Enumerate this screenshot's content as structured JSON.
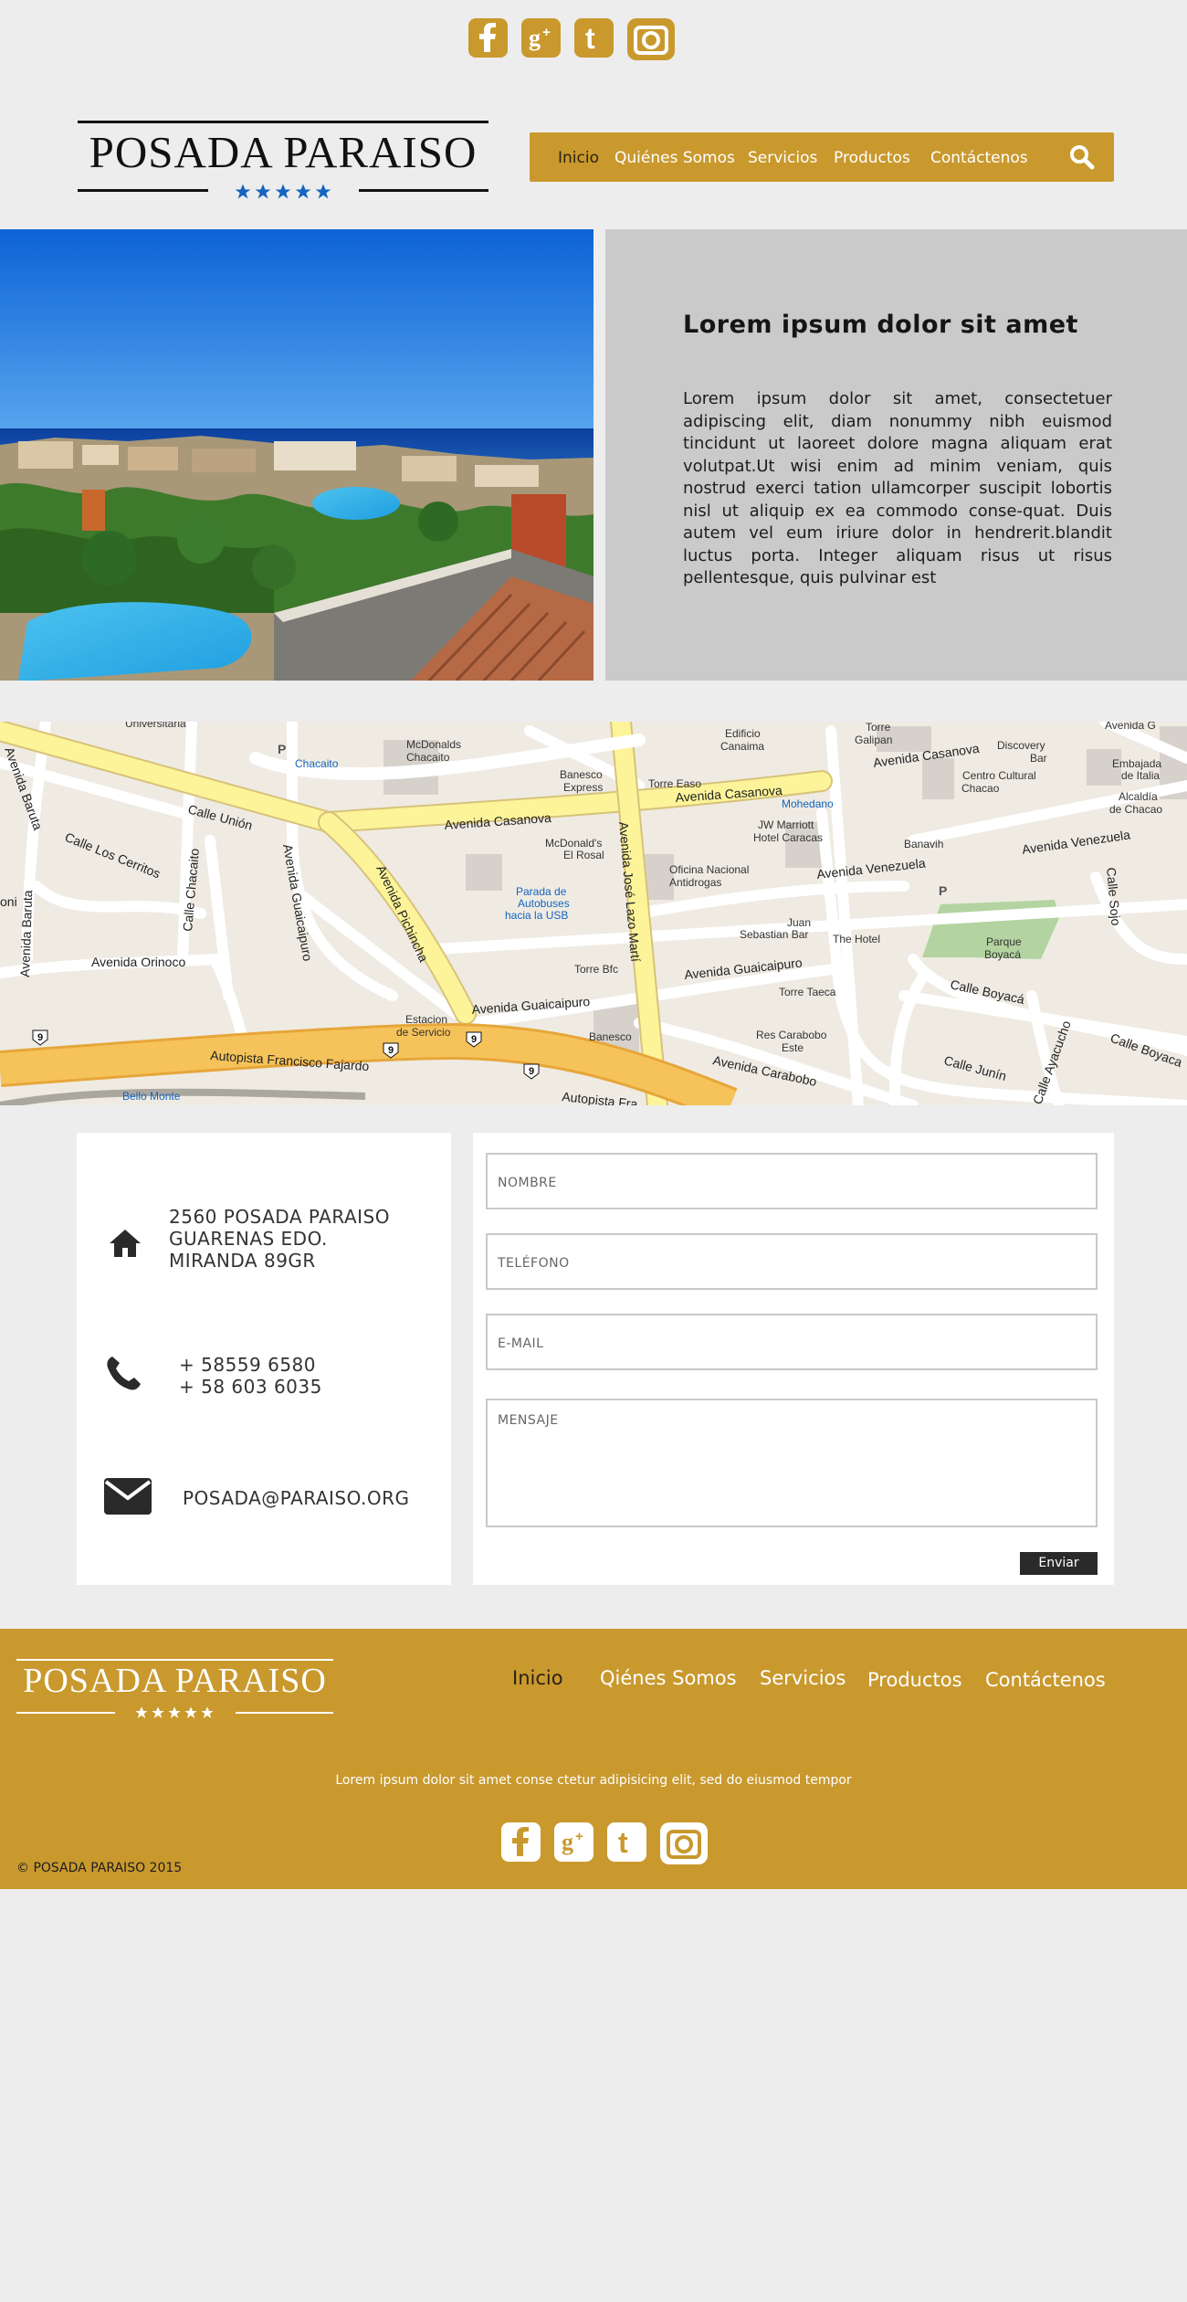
{
  "brand": {
    "name": "POSADA PARAISO",
    "accent_color": "#c9992e",
    "star_color_header": "#1565c0",
    "star_color_footer": "#ffffff",
    "stars": 5
  },
  "social": [
    "facebook-icon",
    "google-plus-icon",
    "tumblr-icon",
    "camera-icon"
  ],
  "nav": {
    "items": [
      "Inicio",
      "Quiénes Somos",
      "Servicios",
      "Productos",
      "Contáctenos"
    ],
    "active": "Inicio"
  },
  "hero": {
    "title": "Lorem ipsum dolor sit amet",
    "body": "Lorem ipsum dolor sit amet, consectetuer adipiscing elit, diam nonummy nibh euismod tincidunt ut laoreet dolore magna aliquam erat volutpat.Ut wisi enim ad minim veniam, quis nostrud exerci tation ullamcorper suscipit lobortis nisl ut aliquip ex ea commodo conse-quat. Duis autem vel eum iriure dolor in hendrerit.blandit luctus porta. Integer aliquam risus ut risus pellentesque, quis pulvinar est"
  },
  "map": {
    "labels": {
      "universitaria": "Universitaria",
      "edificio": "Edificio\nCanaima",
      "torre_galipan": "Torre\nGalipan",
      "avenida_g": "Avenida G",
      "chacaito": "Chacaito",
      "mcdonalds_chacaito": "McDonalds\nChacaito",
      "banesco_express": "Banesco\nExpress",
      "torre_easo": "Torre Easo",
      "av_casanova_1": "Avenida Casanova",
      "av_casanova_2": "Avenida Casanova",
      "av_casanova_3": "Avenida Casanova",
      "discovery": "Discovery\nBar",
      "embajada": "Embajada\nde Italia",
      "centro_cultural": "Centro Cultural\nChacao",
      "alcaldia": "Alcaldía\nde Chacao",
      "calle_union": "Calle Unión",
      "av_baruta": "Avenida Baruta",
      "av_baruta_2": "Avenida Baruta",
      "mohedano": "Mohedano",
      "jw_marriott": "JW Marriott\nHotel Caracas",
      "banavih": "Banavih",
      "av_venezuela_1": "Avenida Venezuela",
      "av_venezuela_2": "Avenida Venezuela",
      "calle_los_cerritos": "Calle Los Cerritos",
      "calle_chacaito": "Calle Chacaito",
      "av_guaicaipuro_v": "Avenida Guaicaipuro",
      "av_pichincha": "Avenida Pichincha",
      "mcdonalds_rosal": "McDonald's\nEl Rosal",
      "av_jose_lazo": "Avenida José Lazo Martí",
      "oficina": "Oficina Nacional\nAntidrogas",
      "calle_sojo": "Calle Sojo",
      "parada": "Parada de\nAutobuses\nhacia la USB",
      "av_orinoco": "Avenida Orinoco",
      "juan_sebastian": "Juan\nSebastian Bar",
      "the_hotel": "The Hotel",
      "parque_boyaca": "Parque\nBoyacá",
      "torre_bfc": "Torre Bfc",
      "av_guaicaipuro_1": "Avenida Guaicaipuro",
      "av_guaicaipuro_2": "Avenida Guaicaipuro",
      "torre_taeca": "Torre Taeca",
      "calle_boyaca_1": "Calle Boyacá",
      "calle_boyaca_2": "Calle Boyaca",
      "estacion": "Estacion\nde Servicio",
      "banesco": "Banesco",
      "res_carabobo": "Res Carabobo\nEste",
      "calle_junin": "Calle Junín",
      "calle_ayacucho": "Calle Ayacucho",
      "autopista_ff": "Autopista Francisco Fajardo",
      "autopista_2": "Autopista Fra",
      "av_carabobo": "Avenida Carabobo",
      "bello_monte": "Bello Monte",
      "p": "P",
      "nine": "9",
      "aoi": "oni"
    }
  },
  "contact": {
    "address_lines": [
      "2560 POSADA PARAISO",
      "GUARENAS EDO.",
      "MIRANDA 89GR"
    ],
    "phones": [
      "+ 58559 6580",
      "+ 58 603 6035"
    ],
    "email": "POSADA@PARAISO.ORG",
    "form": {
      "name_placeholder": "NOMBRE",
      "phone_placeholder": "TELÉFONO",
      "email_placeholder": "E-MAIL",
      "message_placeholder": "MENSAJE",
      "send_label": "Enviar"
    }
  },
  "footer": {
    "nav": [
      "Inicio",
      "Qiénes Somos",
      "Servicios",
      "Productos",
      "Contáctenos"
    ],
    "tagline": "Lorem ipsum dolor sit amet conse ctetur adipisicing elit, sed do eiusmod tempor",
    "copyright": "© POSADA PARAISO 2015"
  }
}
